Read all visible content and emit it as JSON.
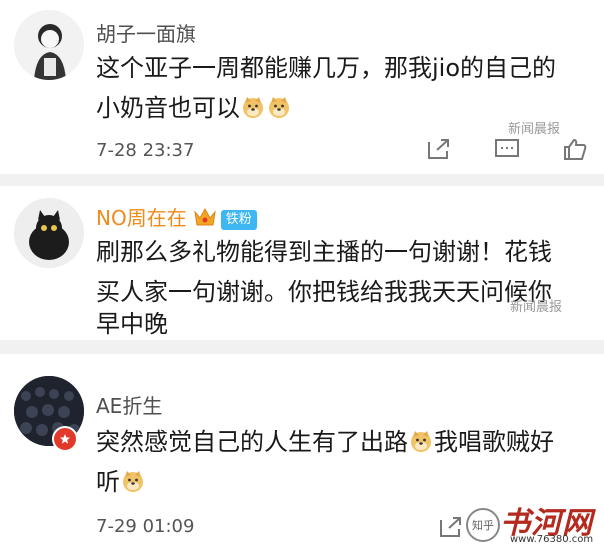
{
  "comments": [
    {
      "user": "胡子一面旗",
      "text_line1": "这个亚子一周都能赚几万，那我jio的自己的",
      "text_line2": "小奶音也可以",
      "time": "7-28 23:37",
      "avatar": "avatar-boy-sketch"
    },
    {
      "user": "NO周在在",
      "fan_badge": "铁粉",
      "text_line1": "刷那么多礼物能得到主播的一句谢谢！花钱",
      "text_line2": "买人家一句谢谢。你把钱给我我天天问候你",
      "text_line3": "早中晚",
      "avatar": "avatar-black-cat"
    },
    {
      "user": "AE折生",
      "text_line1": "突然感觉自己的人生有了出路",
      "text_line1b": "我唱歌贼好",
      "text_line2": "听",
      "time": "7-29 01:09",
      "avatar": "avatar-dark-crowd"
    }
  ],
  "watermarks": {
    "news1": "新闻晨报",
    "news2": "新闻晨报",
    "site": "书河网",
    "site_url": "www.76380.com",
    "zhihu": "知乎"
  },
  "icons": {
    "share": "share-icon",
    "comment": "comment-icon",
    "like": "like-icon",
    "emoji": "doge-emoji"
  }
}
